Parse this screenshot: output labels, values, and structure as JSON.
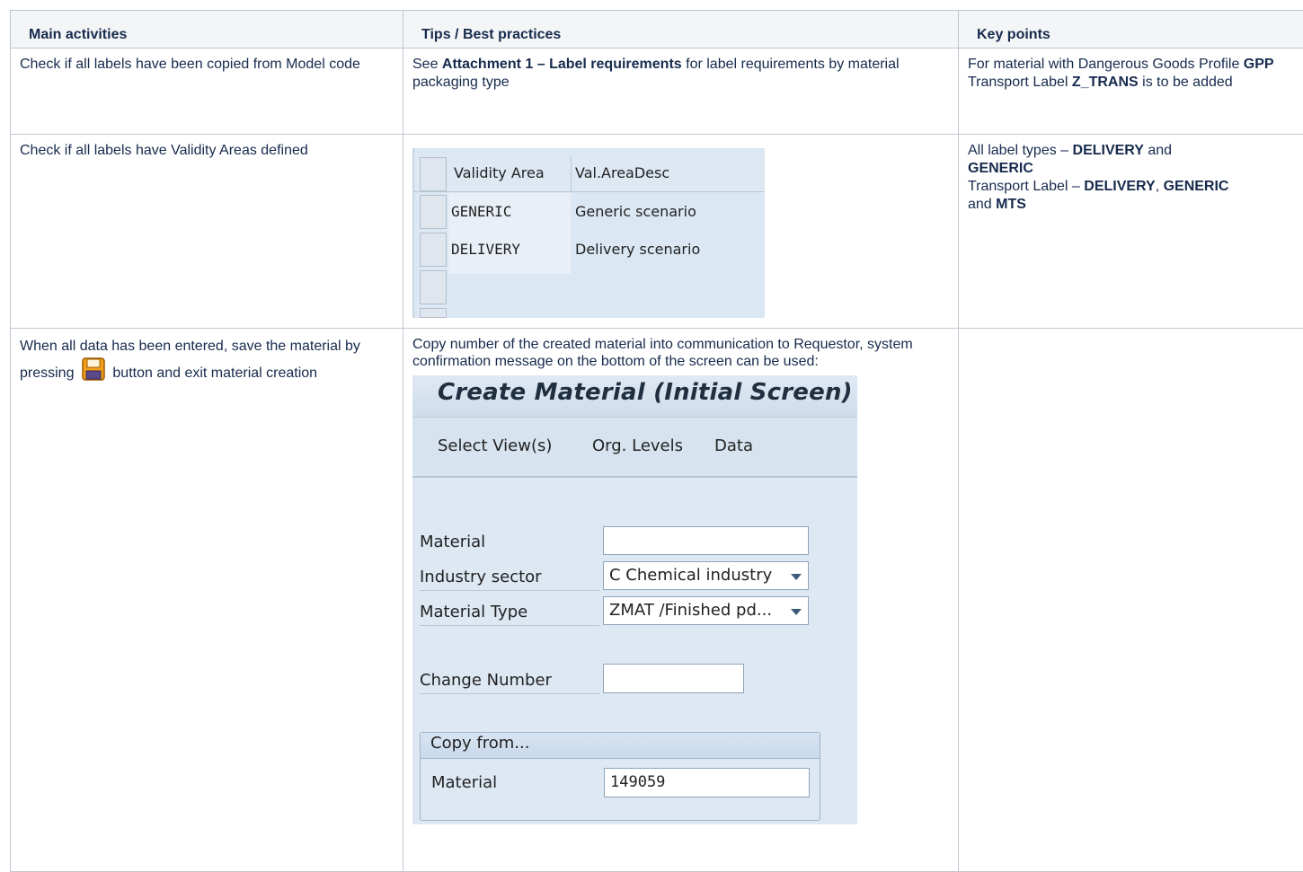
{
  "headers": [
    "Main activities",
    "Tips / Best practices",
    "Key points"
  ],
  "row1": {
    "activity": "Check if all labels have been copied from Model code",
    "tip_pre": "See ",
    "tip_bold": "Attachment 1 – Label requirements",
    "tip_post": " for label requirements by material packaging type",
    "key": {
      "t1": "For material with Dangerous Goods Profile ",
      "b1": "GPP",
      "t2": " Transport Label ",
      "b2": "Z_TRANS",
      "t3": " is to be added"
    }
  },
  "row2": {
    "activity": "Check if all labels have Validity Areas defined",
    "grid": {
      "col1_header": "Validity Area",
      "col2_header": "Val.AreaDesc",
      "rows": [
        {
          "area": "GENERIC",
          "desc": "Generic scenario"
        },
        {
          "area": "DELIVERY",
          "desc": "Delivery scenario"
        }
      ]
    },
    "key": {
      "line1_text": "All label types – ",
      "line1_b1": "DELIVERY",
      "line1_and": " and",
      "line2_b": "GENERIC",
      "line3_text": "Transport Label – ",
      "line3_b1": "DELIVERY",
      "line3_comma": ", ",
      "line3_b2": "GENERIC",
      "line4_and": "and ",
      "line4_b": "MTS"
    }
  },
  "row3": {
    "activity_pre": "When all data has been entered, save the material by pressing",
    "activity_post": "button and exit material creation",
    "tip": "Copy number of the created material into communication to Requestor, system confirmation message on the bottom of the screen can be used:",
    "screen": {
      "title": "Create Material (Initial Screen)",
      "menu": [
        "Select View(s)",
        "Org. Levels",
        "Data"
      ],
      "material_label": "Material",
      "material_value": "",
      "industry_label": "Industry sector",
      "industry_value": "C Chemical industry",
      "type_label": "Material Type",
      "type_value": "ZMAT /Finished pd...",
      "change_label": "Change Number",
      "change_value": "",
      "copy_header": "Copy from...",
      "copy_material_label": "Material",
      "copy_material_value": "149059"
    }
  },
  "colors": {
    "header_bg": "#f4f5f7",
    "border": "#c1c7d0",
    "sap_bg": "#dde8f3",
    "save_icon_orange": "#f2a01a"
  },
  "icons": [
    "save-icon",
    "dropdown-arrow-icon"
  ]
}
